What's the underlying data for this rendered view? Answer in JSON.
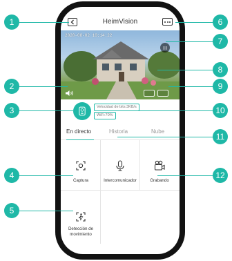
{
  "app": {
    "title": "HeimVision",
    "back_icon": "back-icon",
    "more_icon": "more-icon"
  },
  "video": {
    "timestamp": "2020-08-02  10:14:22",
    "pause_icon": "pause-icon",
    "sound_icon": "speaker-icon",
    "snapshot_icon": "snapshot-icon",
    "record_icon": "record-video-icon"
  },
  "status": {
    "camera_icon": "camera-icon",
    "bitrate": "Velocidad de bits:3KB/s",
    "wifi": "WiFi:70%"
  },
  "tabs": [
    {
      "label": "En directo",
      "active": true
    },
    {
      "label": "Historia",
      "active": false
    },
    {
      "label": "Nube",
      "active": false
    }
  ],
  "functions": [
    {
      "label": "Captura",
      "icon": "capture-icon"
    },
    {
      "label": "Intercomunicador",
      "icon": "microphone-icon"
    },
    {
      "label": "Grabando",
      "icon": "video-camera-icon"
    },
    {
      "label": "Detección de movimiento",
      "icon": "motion-detection-icon"
    }
  ],
  "callouts": [
    "1",
    "2",
    "3",
    "4",
    "5",
    "6",
    "7",
    "8",
    "9",
    "10",
    "11",
    "12"
  ],
  "colors": {
    "accent": "#1fb8a7",
    "text": "#333333",
    "muted": "#999999"
  }
}
